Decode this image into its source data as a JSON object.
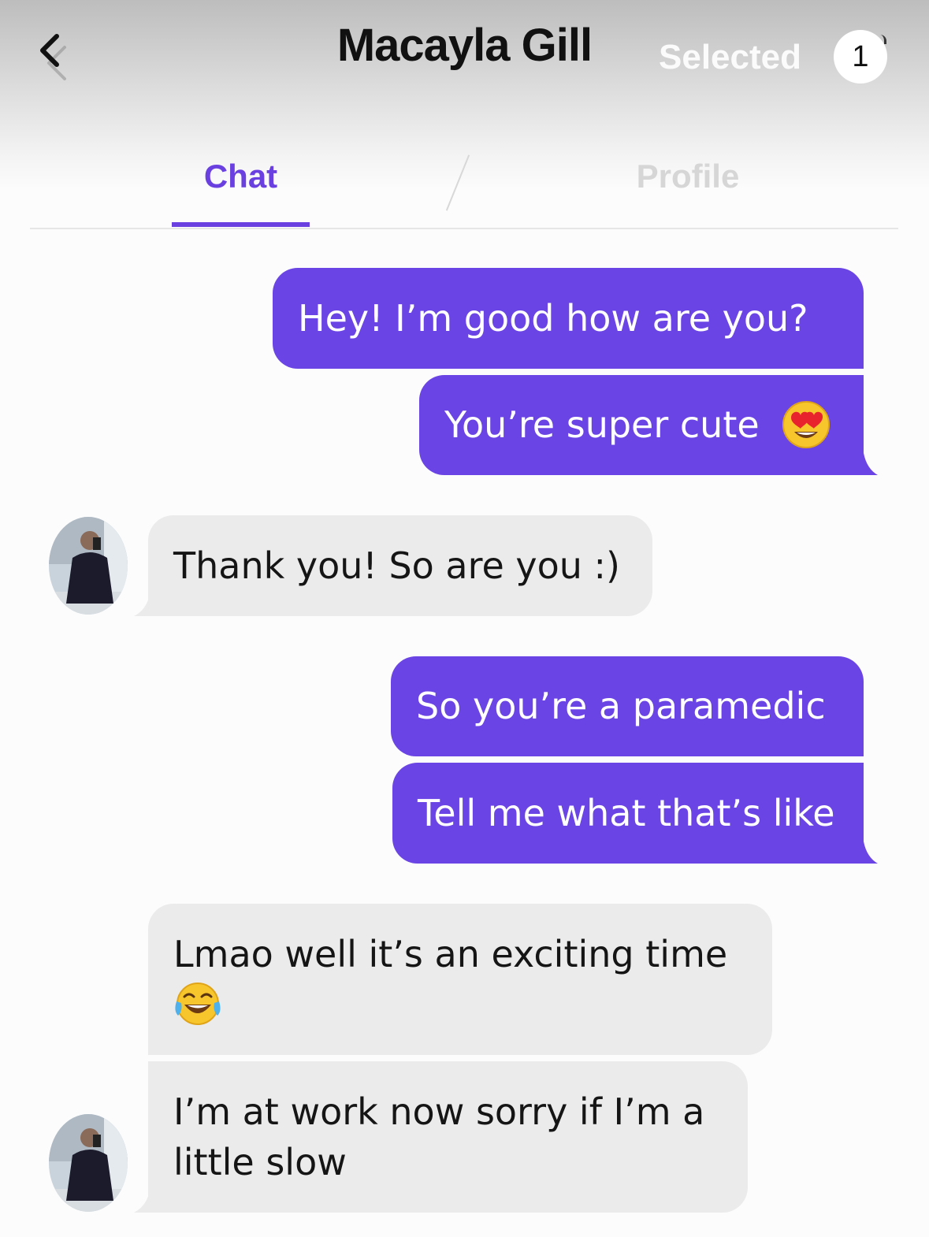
{
  "header": {
    "title": "Macayla Gill",
    "selected_label": "Selected",
    "selected_count": "1"
  },
  "tabs": {
    "chat": "Chat",
    "profile": "Profile"
  },
  "colors": {
    "accent": "#6a44e4",
    "incoming_bubble": "#ebebeb",
    "outgoing_text": "#ffffff"
  },
  "messages": [
    {
      "from": "me",
      "text": "Hey! I’m good how are you?"
    },
    {
      "from": "me",
      "text": "You’re super cute",
      "emoji": "heart-eyes-emoji"
    },
    {
      "from": "them",
      "text": "Thank you! So are you :)"
    },
    {
      "from": "me",
      "text": "So you’re a paramedic"
    },
    {
      "from": "me",
      "text": "Tell me what that’s like"
    },
    {
      "from": "them",
      "text": "Lmao well it’s an exciting time",
      "emoji": "tears-of-joy-emoji"
    },
    {
      "from": "them",
      "line1": "I’m at work now sorry if I’m a",
      "line2": "little slow"
    }
  ]
}
